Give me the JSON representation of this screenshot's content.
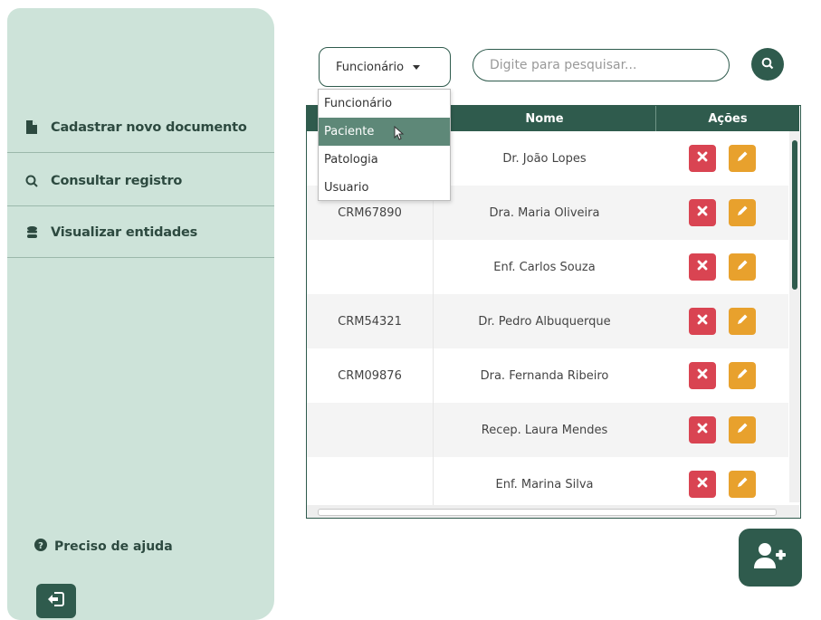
{
  "sidebar": {
    "items": [
      {
        "label": "Cadastrar novo documento",
        "icon": "file-icon"
      },
      {
        "label": "Consultar registro",
        "icon": "search-icon"
      },
      {
        "label": "Visualizar entidades",
        "icon": "database-icon"
      }
    ],
    "help_label": "Preciso de ajuda",
    "logout_icon": "logout-icon"
  },
  "filter": {
    "selected": "Funcionário",
    "options": [
      "Funcionário",
      "Paciente",
      "Patologia",
      "Usuario"
    ],
    "highlighted": "Paciente"
  },
  "search": {
    "placeholder": "Digite para pesquisar..."
  },
  "table": {
    "columns": [
      "",
      "Nome",
      "Ações"
    ],
    "rows": [
      {
        "registro": "",
        "nome": "Dr. João Lopes"
      },
      {
        "registro": "CRM67890",
        "nome": "Dra. Maria Oliveira"
      },
      {
        "registro": "",
        "nome": "Enf. Carlos Souza"
      },
      {
        "registro": "CRM54321",
        "nome": "Dr. Pedro Albuquerque"
      },
      {
        "registro": "CRM09876",
        "nome": "Dra. Fernanda Ribeiro"
      },
      {
        "registro": "",
        "nome": "Recep. Laura Mendes"
      },
      {
        "registro": "",
        "nome": "Enf. Marina Silva"
      }
    ]
  },
  "colors": {
    "primary": "#2f5b4d",
    "sidebar_bg": "#cde3d9",
    "delete": "#d94452",
    "edit": "#e8a12d"
  }
}
